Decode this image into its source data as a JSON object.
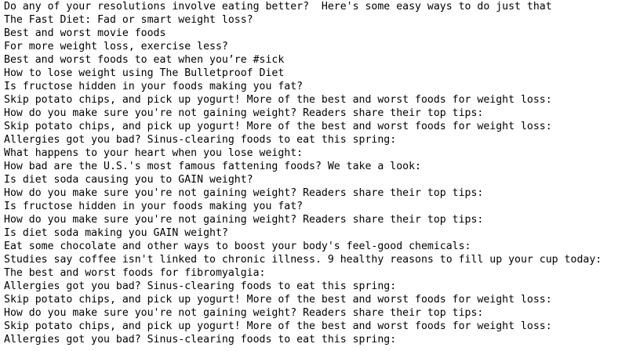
{
  "lines": [
    "Do any of your resolutions involve eating better?  Here's some easy ways to do just that",
    "The Fast Diet: Fad or smart weight loss?",
    "Best and worst movie foods",
    "For more weight loss, exercise less?",
    "Best and worst foods to eat when you’re #sick",
    "How to lose weight using The Bulletproof Diet",
    "Is fructose hidden in your foods making you fat?",
    "Skip potato chips, and pick up yogurt! More of the best and worst foods for weight loss:",
    "How do you make sure you're not gaining weight? Readers share their top tips:",
    "Skip potato chips, and pick up yogurt! More of the best and worst foods for weight loss:",
    "Allergies got you bad? Sinus-clearing foods to eat this spring:",
    "What happens to your heart when you lose weight:",
    "How bad are the U.S.'s most famous fattening foods? We take a look:",
    "Is diet soda causing you to GAIN weight?",
    "How do you make sure you're not gaining weight? Readers share their top tips:",
    "Is fructose hidden in your foods making you fat?",
    "How do you make sure you're not gaining weight? Readers share their top tips:",
    "Is diet soda making you GAIN weight?",
    "Eat some chocolate and other ways to boost your body's feel-good chemicals:",
    "Studies say coffee isn't linked to chronic illness. 9 healthy reasons to fill up your cup today:",
    "The best and worst foods for fibromyalgia:",
    "Allergies got you bad? Sinus-clearing foods to eat this spring:",
    "Skip potato chips, and pick up yogurt! More of the best and worst foods for weight loss:",
    "How do you make sure you're not gaining weight? Readers share their top tips:",
    "Skip potato chips, and pick up yogurt! More of the best and worst foods for weight loss:",
    "Allergies got you bad? Sinus-clearing foods to eat this spring:"
  ]
}
